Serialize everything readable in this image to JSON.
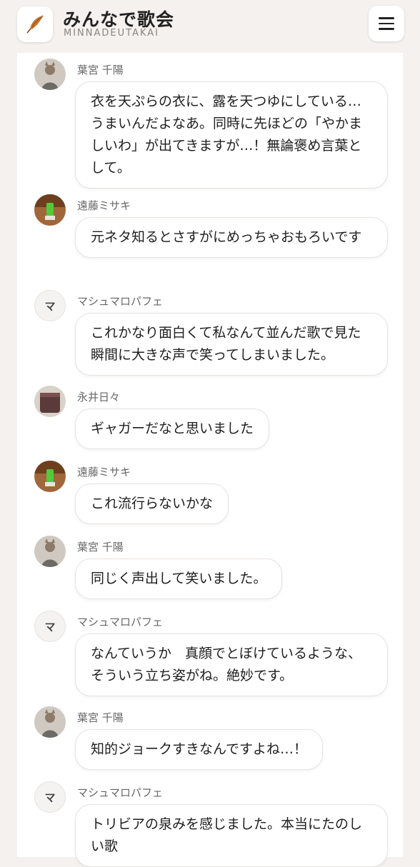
{
  "header": {
    "title": "みんなで歌会",
    "subtitle": "MINNADEUTAKAI",
    "logo_icon": "feather-icon",
    "menu_icon": "hamburger-menu-icon"
  },
  "messages": [
    {
      "name": "葉宮 千陽",
      "text": "衣を天ぷらの衣に、露を天つゆにしている…うまいんだよなあ。同時に先ほどの「やかましいわ」が出てきますが…！無論褒め言葉として。"
    },
    {
      "name": "遠藤ミサキ",
      "text": "元ネタ知るとさすがにめっちゃおもろいです"
    },
    {
      "name": "マシュマロパフェ",
      "avatar_letter": "マ",
      "text": "これかなり面白くて私なんて並んだ歌で見た瞬間に大きな声で笑ってしまいました。"
    },
    {
      "name": "永井日々",
      "text": "ギャガーだなと思いました"
    },
    {
      "name": "遠藤ミサキ",
      "text": "これ流行らないかな"
    },
    {
      "name": "葉宮 千陽",
      "text": "同じく声出して笑いました。"
    },
    {
      "name": "マシュマロパフェ",
      "avatar_letter": "マ",
      "text": "なんていうか　真顔でとぼけているような、そういう立ち姿がね。絶妙です。"
    },
    {
      "name": "葉宮 千陽",
      "text": "知的ジョークすきなんですよね…！"
    },
    {
      "name": "マシュマロパフェ",
      "avatar_letter": "マ",
      "text": "トリビアの泉みを感じました。本当にたのしい歌"
    }
  ]
}
